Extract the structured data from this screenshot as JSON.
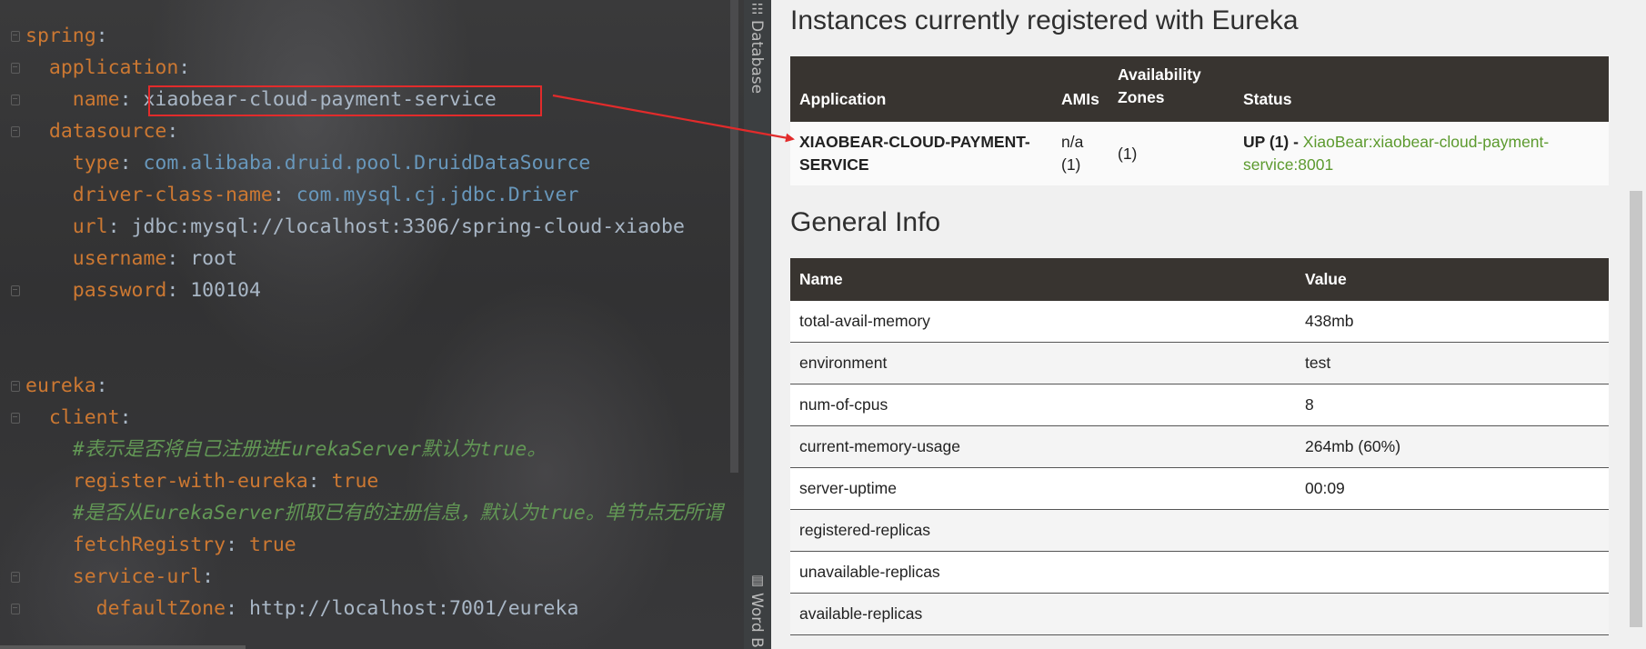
{
  "editor": {
    "lines": [
      {
        "indent": "",
        "key": "spring",
        "sep": ":",
        "value": "",
        "value_kind": ""
      },
      {
        "indent": "  ",
        "key": "application",
        "sep": ":",
        "value": "",
        "value_kind": ""
      },
      {
        "indent": "    ",
        "key": "name",
        "sep": ": ",
        "value": "xiaobear-cloud-payment-service",
        "value_kind": "plain"
      },
      {
        "indent": "  ",
        "key": "datasource",
        "sep": ":",
        "value": "",
        "value_kind": ""
      },
      {
        "indent": "    ",
        "key": "type",
        "sep": ": ",
        "value": "com.alibaba.druid.pool.DruidDataSource",
        "value_kind": "class"
      },
      {
        "indent": "    ",
        "key": "driver-class-name",
        "sep": ": ",
        "value": "com.mysql.cj.jdbc.Driver",
        "value_kind": "class"
      },
      {
        "indent": "    ",
        "key": "url",
        "sep": ": ",
        "value": "jdbc:mysql://localhost:3306/spring-cloud-xiaobe",
        "value_kind": "plain"
      },
      {
        "indent": "    ",
        "key": "username",
        "sep": ": ",
        "value": "root",
        "value_kind": "plain"
      },
      {
        "indent": "    ",
        "key": "password",
        "sep": ": ",
        "value": "100104",
        "value_kind": "plain"
      },
      {
        "indent": "",
        "key": "",
        "sep": "",
        "value": "",
        "value_kind": ""
      },
      {
        "indent": "",
        "key": "",
        "sep": "",
        "value": "",
        "value_kind": ""
      },
      {
        "indent": "",
        "key": "eureka",
        "sep": ":",
        "value": "",
        "value_kind": ""
      },
      {
        "indent": "  ",
        "key": "client",
        "sep": ":",
        "value": "",
        "value_kind": ""
      },
      {
        "indent": "    ",
        "key": "",
        "sep": "",
        "value": "#表示是否将自己注册进EurekaServer默认为true。",
        "value_kind": "comment"
      },
      {
        "indent": "    ",
        "key": "register-with-eureka",
        "sep": ": ",
        "value": "true",
        "value_kind": "bool"
      },
      {
        "indent": "    ",
        "key": "",
        "sep": "",
        "value": "#是否从EurekaServer抓取已有的注册信息，默认为true。单节点无所谓",
        "value_kind": "comment"
      },
      {
        "indent": "    ",
        "key": "fetchRegistry",
        "sep": ": ",
        "value": "true",
        "value_kind": "bool"
      },
      {
        "indent": "    ",
        "key": "service-url",
        "sep": ":",
        "value": "",
        "value_kind": ""
      },
      {
        "indent": "      ",
        "key": "defaultZone",
        "sep": ": ",
        "value": "http://localhost:7001/eureka",
        "value_kind": "plain"
      }
    ]
  },
  "tool_strip": {
    "database_label": "Database",
    "database_icon": "database-icon",
    "word_label": "Word B",
    "word_icon": "book-icon"
  },
  "eureka": {
    "instances_title": "Instances currently registered with Eureka",
    "instances_headers": {
      "application": "Application",
      "amis": "AMIs",
      "zones": "Availability Zones",
      "status": "Status"
    },
    "instance": {
      "application": "XIAOBEAR-CLOUD-PAYMENT-SERVICE",
      "amis": "n/a (1)",
      "zones": "(1)",
      "status_prefix": "UP (1) - ",
      "status_link": "XiaoBear:xiaobear-cloud-payment-service:8001"
    },
    "general_title": "General Info",
    "general_headers": {
      "name": "Name",
      "value": "Value"
    },
    "general_rows": [
      {
        "name": "total-avail-memory",
        "value": "438mb"
      },
      {
        "name": "environment",
        "value": "test"
      },
      {
        "name": "num-of-cpus",
        "value": "8"
      },
      {
        "name": "current-memory-usage",
        "value": "264mb (60%)"
      },
      {
        "name": "server-uptime",
        "value": "00:09"
      },
      {
        "name": "registered-replicas",
        "value": ""
      },
      {
        "name": "unavailable-replicas",
        "value": ""
      },
      {
        "name": "available-replicas",
        "value": ""
      }
    ]
  },
  "colors": {
    "key": "#cc7832",
    "class_value": "#6897bb",
    "comment": "#629755",
    "annotation": "#e22b2b",
    "table_header": "#383430",
    "link": "#5c9a2e"
  }
}
